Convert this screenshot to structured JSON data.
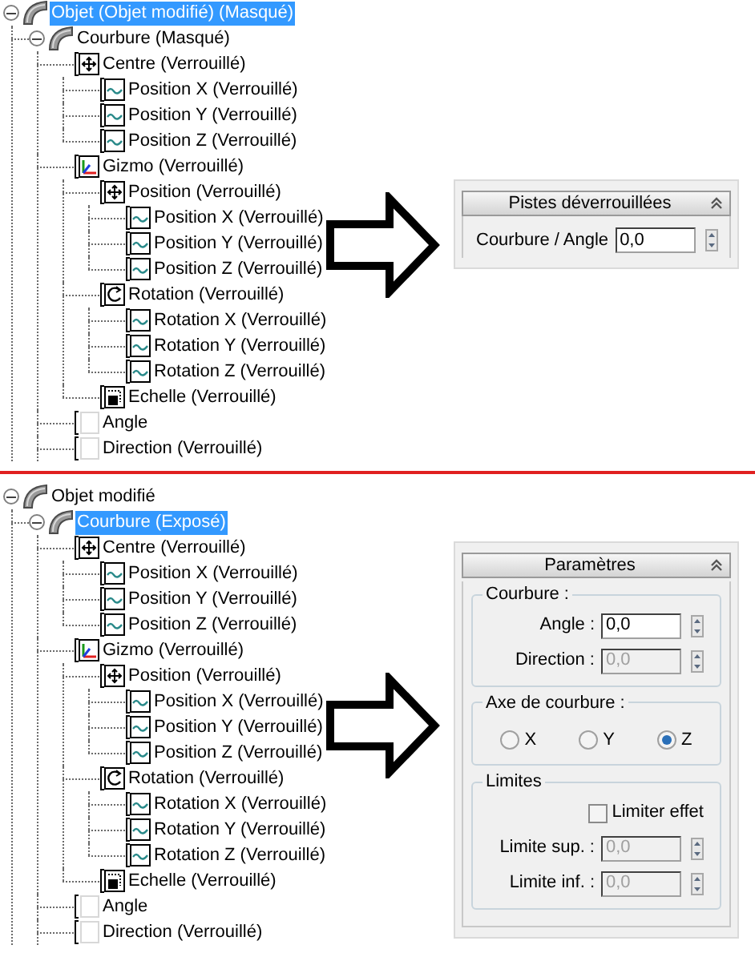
{
  "sections": [
    {
      "tree": {
        "label": "Objet (Objet modifié) (Masqué)",
        "kind": "bend",
        "selected": true,
        "expanded": true,
        "children": [
          {
            "label": "Courbure (Masqué)",
            "kind": "bend",
            "selected": false,
            "expanded": true,
            "children": [
              {
                "label": "Centre (Verrouillé)",
                "kind": "position",
                "selected": false,
                "children": [
                  {
                    "label": "Position X (Verrouillé)",
                    "kind": "float",
                    "selected": false
                  },
                  {
                    "label": "Position Y (Verrouillé)",
                    "kind": "float",
                    "selected": false
                  },
                  {
                    "label": "Position Z (Verrouillé)",
                    "kind": "float",
                    "selected": false
                  }
                ]
              },
              {
                "label": "Gizmo (Verrouillé)",
                "kind": "gizmo",
                "selected": false,
                "children": [
                  {
                    "label": "Position (Verrouillé)",
                    "kind": "position",
                    "selected": false,
                    "children": [
                      {
                        "label": "Position X (Verrouillé)",
                        "kind": "float",
                        "selected": false
                      },
                      {
                        "label": "Position Y (Verrouillé)",
                        "kind": "float",
                        "selected": false
                      },
                      {
                        "label": "Position Z (Verrouillé)",
                        "kind": "float",
                        "selected": false
                      }
                    ]
                  },
                  {
                    "label": "Rotation (Verrouillé)",
                    "kind": "rotation",
                    "selected": false,
                    "children": [
                      {
                        "label": "Rotation X (Verrouillé)",
                        "kind": "float",
                        "selected": false
                      },
                      {
                        "label": "Rotation Y (Verrouillé)",
                        "kind": "float",
                        "selected": false
                      },
                      {
                        "label": "Rotation Z (Verrouillé)",
                        "kind": "float",
                        "selected": false
                      }
                    ]
                  },
                  {
                    "label": "Echelle (Verrouillé)",
                    "kind": "scale",
                    "selected": false
                  }
                ]
              },
              {
                "label": "Angle",
                "kind": "empty",
                "selected": false
              },
              {
                "label": "Direction (Verrouillé)",
                "kind": "empty",
                "selected": false
              }
            ]
          }
        ]
      },
      "panel": {
        "title": "Pistes déverrouillées",
        "groups": [
          {
            "items": [
              {
                "kind": "spinner",
                "label": "Courbure / Angle",
                "value": "0,0",
                "disabled": false
              }
            ]
          }
        ]
      }
    },
    {
      "tree": {
        "label": "Objet modifié",
        "kind": "bend",
        "selected": false,
        "expanded": true,
        "children": [
          {
            "label": "Courbure (Exposé)",
            "kind": "bend",
            "selected": true,
            "expanded": true,
            "children": [
              {
                "label": "Centre (Verrouillé)",
                "kind": "position",
                "selected": false,
                "children": [
                  {
                    "label": "Position X (Verrouillé)",
                    "kind": "float",
                    "selected": false
                  },
                  {
                    "label": "Position Y (Verrouillé)",
                    "kind": "float",
                    "selected": false
                  },
                  {
                    "label": "Position Z (Verrouillé)",
                    "kind": "float",
                    "selected": false
                  }
                ]
              },
              {
                "label": "Gizmo (Verrouillé)",
                "kind": "gizmo",
                "selected": false,
                "children": [
                  {
                    "label": "Position (Verrouillé)",
                    "kind": "position",
                    "selected": false,
                    "children": [
                      {
                        "label": "Position X (Verrouillé)",
                        "kind": "float",
                        "selected": false
                      },
                      {
                        "label": "Position Y (Verrouillé)",
                        "kind": "float",
                        "selected": false
                      },
                      {
                        "label": "Position Z (Verrouillé)",
                        "kind": "float",
                        "selected": false
                      }
                    ]
                  },
                  {
                    "label": "Rotation (Verrouillé)",
                    "kind": "rotation",
                    "selected": false,
                    "children": [
                      {
                        "label": "Rotation X (Verrouillé)",
                        "kind": "float",
                        "selected": false
                      },
                      {
                        "label": "Rotation Y (Verrouillé)",
                        "kind": "float",
                        "selected": false
                      },
                      {
                        "label": "Rotation Z (Verrouillé)",
                        "kind": "float",
                        "selected": false
                      }
                    ]
                  },
                  {
                    "label": "Echelle (Verrouillé)",
                    "kind": "scale",
                    "selected": false
                  }
                ]
              },
              {
                "label": "Angle",
                "kind": "empty",
                "selected": false
              },
              {
                "label": "Direction (Verrouillé)",
                "kind": "empty",
                "selected": false
              }
            ]
          }
        ]
      },
      "panel": {
        "title": "Paramètres",
        "groups": [
          {
            "title": "Courbure :",
            "items": [
              {
                "kind": "spinner",
                "label": "Angle :",
                "value": "0,0",
                "disabled": false
              },
              {
                "kind": "spinner",
                "label": "Direction :",
                "value": "0,0",
                "disabled": true
              }
            ]
          },
          {
            "title": "Axe de courbure :",
            "items": [
              {
                "kind": "radios",
                "options": [
                  {
                    "label": "X",
                    "selected": false
                  },
                  {
                    "label": "Y",
                    "selected": false
                  },
                  {
                    "label": "Z",
                    "selected": true
                  }
                ]
              }
            ]
          },
          {
            "title": "Limites",
            "items": [
              {
                "kind": "checkbox",
                "label": "Limiter effet",
                "checked": false
              },
              {
                "kind": "spinner",
                "label": "Limite sup. :",
                "value": "0,0",
                "disabled": true
              },
              {
                "kind": "spinner",
                "label": "Limite inf. :",
                "value": "0,0",
                "disabled": true
              }
            ]
          }
        ]
      }
    }
  ]
}
